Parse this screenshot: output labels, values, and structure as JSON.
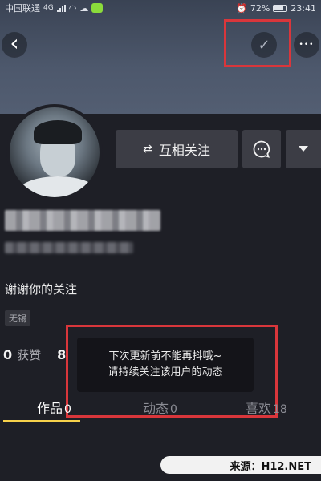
{
  "status_bar": {
    "carrier": "中国联通",
    "network": "4G",
    "battery": "72%",
    "time": "23:41"
  },
  "nav": {
    "back_icon": "‹",
    "check_icon": "✓",
    "more_icon": "•••"
  },
  "profile": {
    "follow_button_label": "互相关注",
    "follow_icon": "⇄",
    "bio": "谢谢你的关注",
    "tag": "无锡",
    "likes_count": "0",
    "likes_label": "获赞",
    "following_count_partial": "8"
  },
  "toast": {
    "line1": "下次更新前不能再抖哦~",
    "line2": "请持续关注该用户的动态"
  },
  "tabs": [
    {
      "label": "作品",
      "count": "0",
      "active": true
    },
    {
      "label": "动态",
      "count": "0",
      "active": false
    },
    {
      "label": "喜欢",
      "count": "18",
      "active": false
    }
  ],
  "watermark": "来源：H12.NET",
  "colors": {
    "highlight": "#d9363b",
    "tab_underline": "#f7d24b",
    "background": "#1e1f26"
  }
}
